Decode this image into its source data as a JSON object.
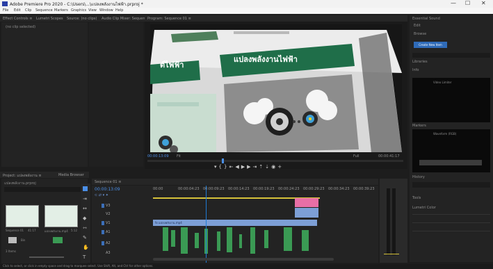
{
  "window": {
    "title": "Adobe Premiere Pro 2020 - C:\\Users\\...\\แปลงพลังงานไฟฟ้า.prproj *",
    "minimize": "—",
    "maximize": "☐",
    "close": "✕"
  },
  "menu": [
    "File",
    "Edit",
    "Clip",
    "Sequence",
    "Markers",
    "Graphics",
    "View",
    "Window",
    "Help"
  ],
  "source_tabs": [
    "Effect Controls ≡",
    "Lumetri Scopes",
    "Source: (no clips)",
    "Audio Clip Mixer: Sequence 01"
  ],
  "effect_controls_label": "(no clip selected)",
  "program": {
    "tab": "Program: Sequence 01 ≡",
    "slide_header_left": "ต์ไฟฟ้า",
    "slide_header_right": "แปลงพลังงานไฟฟ้า",
    "timecode": "00:00:13:09",
    "fit": "Fit",
    "quality": "Full",
    "duration": "00:00:41:17"
  },
  "project_panel": {
    "tabs": [
      "Project: แปลงพลังงาน ≡",
      "Media Browser"
    ],
    "file": "แปลงพลังงาน.prproj",
    "items": [
      {
        "name": "Sequence 01",
        "duration": "41:17"
      },
      {
        "name": "แปลงพลังงาน.mp4",
        "duration": "5:12"
      }
    ],
    "folder_items": [
      {
        "name": "Bin"
      },
      {
        "name": ""
      }
    ],
    "count": "3 Items"
  },
  "timeline": {
    "tab": "Sequence 01 ≡",
    "timecode": "00:00:13:09",
    "ruler": [
      "00:00",
      "00:00:04:23",
      "00:00:09:23",
      "00:00:14:23",
      "00:00:19:23",
      "00:00:24:23",
      "00:00:29:23",
      "00:00:34:23",
      "00:00:39:23"
    ],
    "tracks": [
      "V3",
      "V2",
      "V1",
      "A1",
      "A2",
      "A3"
    ],
    "clip_v1": "fx แปลงพลังงาน.mp4"
  },
  "right_panel": {
    "title": "Essential Sound",
    "items": [
      "Edit",
      "Browse"
    ],
    "button": "Create New Item",
    "labels": [
      "Libraries",
      "Info",
      "Markers",
      "History",
      "Tools",
      "Lumetri Color"
    ],
    "meter_title": "Video Limiter",
    "scope_title": "Waveform (RGB)"
  },
  "status": {
    "text": "Click to select, or click in empty space and drag to marquee select. Use Shift, Alt, and Ctrl for other options."
  },
  "colors": {
    "accent_blue": "#4b8fe8",
    "slide_green": "#1f6e49",
    "clip_blue": "#7d9fd6",
    "clip_pink": "#e86fa6",
    "audio_green": "#3a9a54",
    "playhead": "#1f7bd6"
  }
}
